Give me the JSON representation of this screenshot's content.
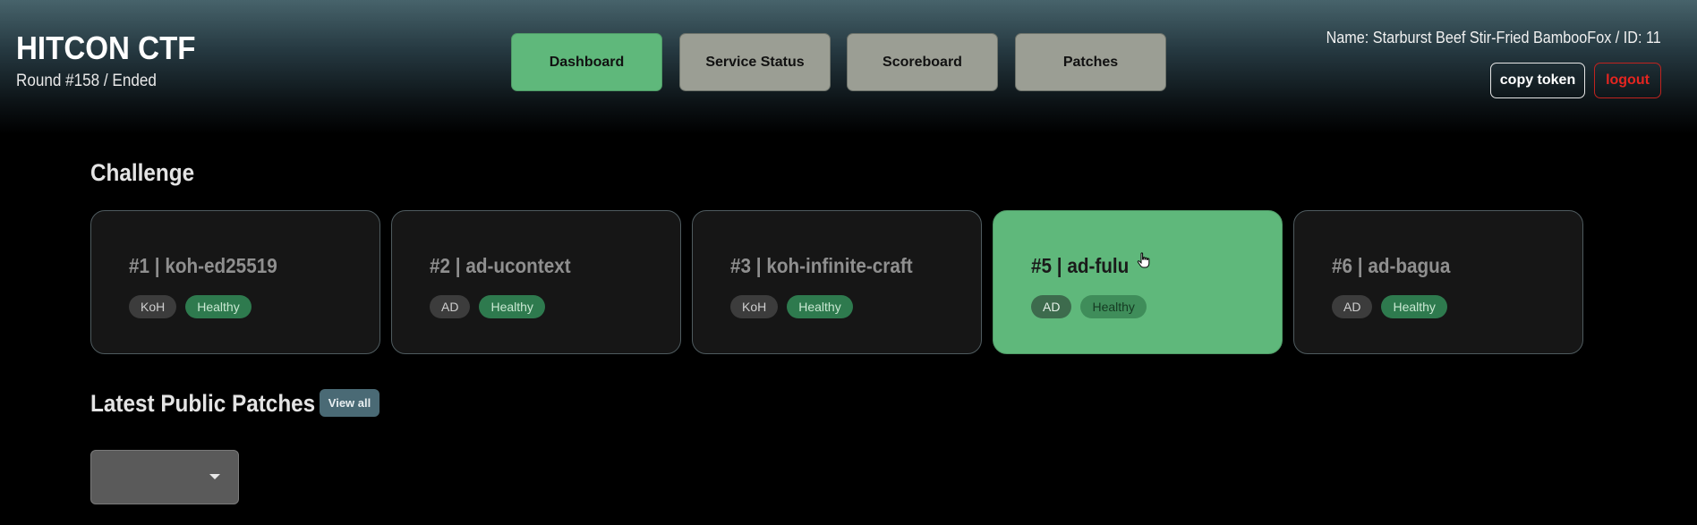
{
  "header": {
    "title": "HITCON CTF",
    "round": "Round #158 / Ended",
    "nav": [
      {
        "label": "Dashboard",
        "active": true
      },
      {
        "label": "Service Status",
        "active": false
      },
      {
        "label": "Scoreboard",
        "active": false
      },
      {
        "label": "Patches",
        "active": false
      }
    ],
    "user": {
      "name": "Name: Starburst Beef Stir-Fried BambooFox / ID: 11",
      "copy_token_label": "copy token",
      "logout_label": "logout"
    }
  },
  "challenge_section": {
    "title": "Challenge",
    "cards": [
      {
        "title": "#1 | koh-ed25519",
        "type": "KoH",
        "status": "Healthy",
        "active": false
      },
      {
        "title": "#2 | ad-ucontext",
        "type": "AD",
        "status": "Healthy",
        "active": false
      },
      {
        "title": "#3 | koh-infinite-craft",
        "type": "KoH",
        "status": "Healthy",
        "active": false
      },
      {
        "title": "#5 | ad-fulu",
        "type": "AD",
        "status": "Healthy",
        "active": true
      },
      {
        "title": "#6 | ad-bagua",
        "type": "AD",
        "status": "Healthy",
        "active": false
      }
    ]
  },
  "patches_section": {
    "title": "Latest Public Patches",
    "view_all_label": "View all",
    "select_value": ""
  },
  "colors": {
    "accent_green": "#5fb87b",
    "nav_inactive": "#9b9e94",
    "healthy_tag": "#2e7a4e",
    "logout_red": "#e52520",
    "view_all_bg": "#4a6a75"
  }
}
